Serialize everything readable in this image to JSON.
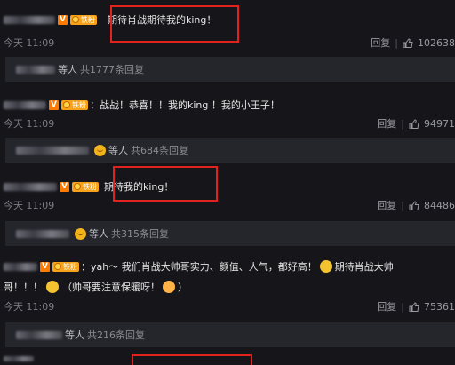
{
  "comments": [
    {
      "text": "期待肖战期待我的king！",
      "time": "今天 11:09",
      "reply_label": "回复",
      "likes": "102638"
    },
    {
      "text": "：战战！恭喜！！我的king ！我的小王子！",
      "time": "今天 11:09",
      "reply_label": "回复",
      "likes": "94971"
    },
    {
      "text": "期待我的king！",
      "time": "今天 11:09",
      "reply_label": "回复",
      "likes": "84486"
    },
    {
      "text_line1": "：yah～ 我们肖战大帅哥实力、颜值、人气，都好高！",
      "text_line1_tail": "期待肖战大帅",
      "text_line2_a": "哥！！！",
      "text_line2_b": "（帅哥要注意保暖呀！",
      "text_line2_c": "）",
      "time": "今天 11:09",
      "reply_label": "回复",
      "likes": "75361"
    }
  ],
  "reply_bars": [
    {
      "people": "等人",
      "count": "共1777条回复"
    },
    {
      "people": "等人",
      "count": "共684条回复"
    },
    {
      "people": "等人",
      "count": "共315条回复"
    },
    {
      "people": "等人",
      "count": "共216条回复"
    }
  ],
  "badges": {
    "vip": "V",
    "fan_label": "铁粉",
    "separator": "|"
  },
  "colors": {
    "background": "#15151a",
    "highlight_box": "#e0231c",
    "vip_badge": "#ff7a00",
    "fan_badge": "#f7a21b"
  }
}
